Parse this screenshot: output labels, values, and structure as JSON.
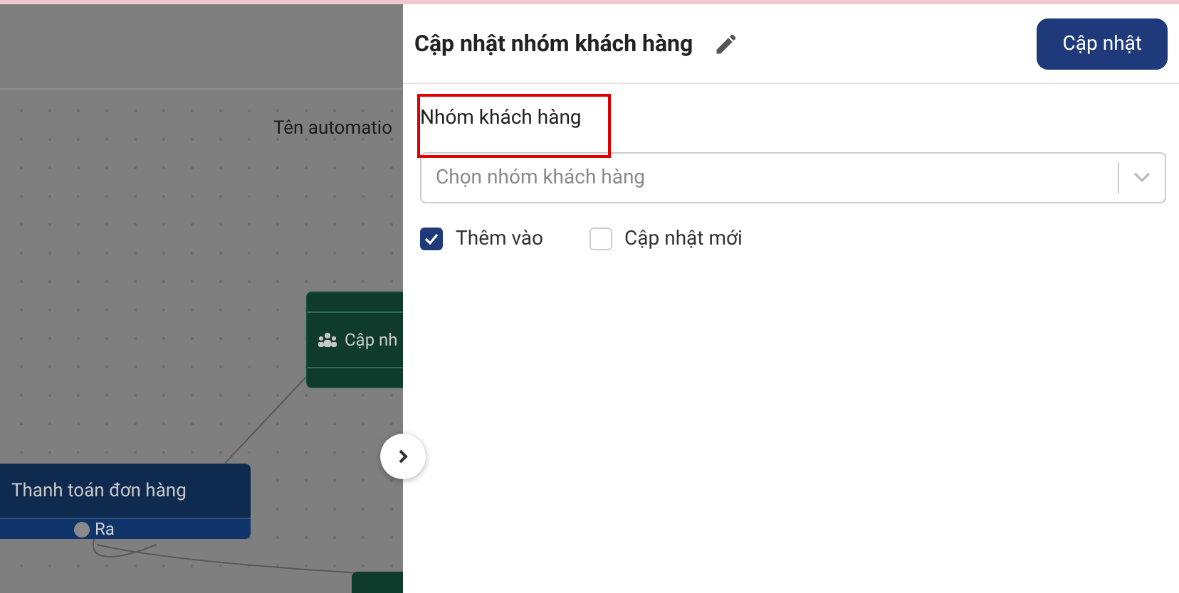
{
  "canvas": {
    "automation_name_label": "Tên automatio",
    "nodes": [
      {
        "kind": "action",
        "title": "Cập nh"
      },
      {
        "kind": "trigger",
        "title": "Thanh toán đơn hàng",
        "port": "Ra"
      },
      {
        "kind": "stub"
      }
    ]
  },
  "panel": {
    "title": "Cập nhật nhóm khách hàng",
    "submit": "Cập nhật",
    "field": {
      "label": "Nhóm khách hàng",
      "placeholder": "Chọn nhóm khách hàng",
      "highlighted": true
    },
    "options": [
      {
        "label": "Thêm vào",
        "checked": true
      },
      {
        "label": "Cập nhật mới",
        "checked": false
      }
    ]
  }
}
